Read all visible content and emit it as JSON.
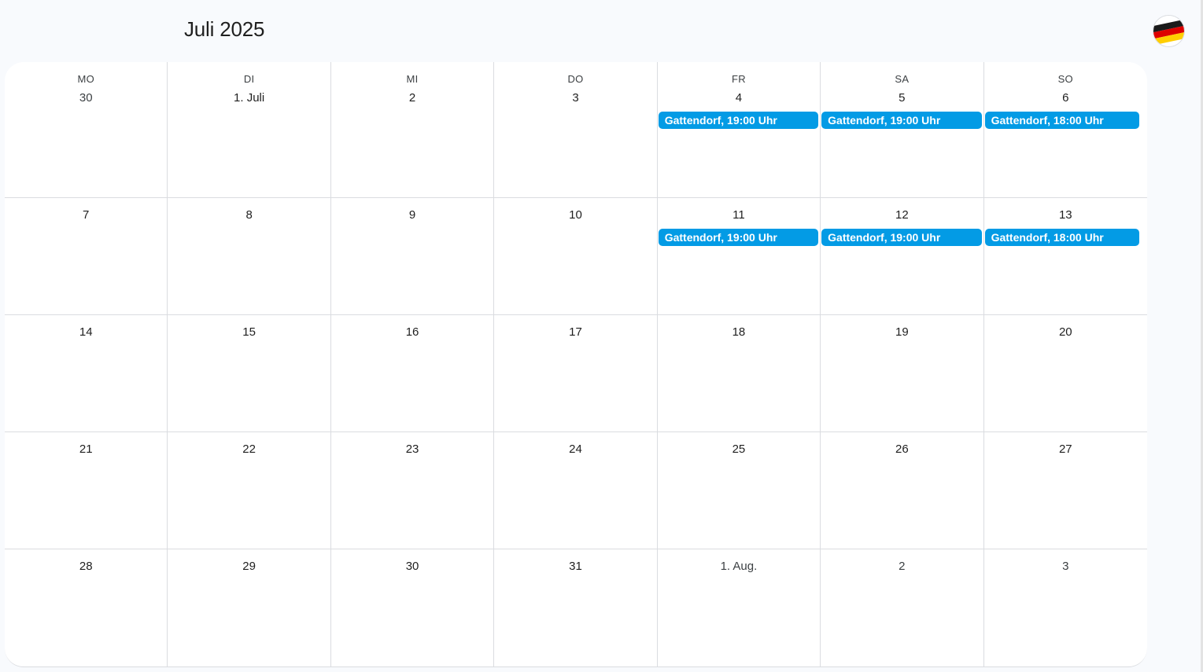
{
  "header": {
    "title": "Juli 2025",
    "avatar_icon": "flag-avatar-icon"
  },
  "colors": {
    "event": "#039be5",
    "grid_line": "#dadce0",
    "background": "#f8fafd"
  },
  "weekdays": [
    "MO",
    "DI",
    "MI",
    "DO",
    "FR",
    "SA",
    "SO"
  ],
  "weeks": [
    [
      {
        "label": "30",
        "other": true,
        "events": []
      },
      {
        "label": "1. Juli",
        "events": []
      },
      {
        "label": "2",
        "events": []
      },
      {
        "label": "3",
        "events": []
      },
      {
        "label": "4",
        "events": [
          "Gattendorf, 19:00 Uhr"
        ]
      },
      {
        "label": "5",
        "events": [
          "Gattendorf, 19:00 Uhr"
        ]
      },
      {
        "label": "6",
        "events": [
          "Gattendorf, 18:00 Uhr"
        ]
      }
    ],
    [
      {
        "label": "7",
        "events": []
      },
      {
        "label": "8",
        "events": []
      },
      {
        "label": "9",
        "events": []
      },
      {
        "label": "10",
        "events": []
      },
      {
        "label": "11",
        "events": [
          "Gattendorf, 19:00 Uhr"
        ]
      },
      {
        "label": "12",
        "events": [
          "Gattendorf, 19:00 Uhr"
        ]
      },
      {
        "label": "13",
        "events": [
          "Gattendorf, 18:00 Uhr"
        ]
      }
    ],
    [
      {
        "label": "14",
        "events": []
      },
      {
        "label": "15",
        "events": []
      },
      {
        "label": "16",
        "events": []
      },
      {
        "label": "17",
        "events": []
      },
      {
        "label": "18",
        "events": []
      },
      {
        "label": "19",
        "events": []
      },
      {
        "label": "20",
        "events": []
      }
    ],
    [
      {
        "label": "21",
        "events": []
      },
      {
        "label": "22",
        "events": []
      },
      {
        "label": "23",
        "events": []
      },
      {
        "label": "24",
        "events": []
      },
      {
        "label": "25",
        "events": []
      },
      {
        "label": "26",
        "events": []
      },
      {
        "label": "27",
        "events": []
      }
    ],
    [
      {
        "label": "28",
        "events": []
      },
      {
        "label": "29",
        "events": []
      },
      {
        "label": "30",
        "events": []
      },
      {
        "label": "31",
        "events": []
      },
      {
        "label": "1. Aug.",
        "other": true,
        "events": []
      },
      {
        "label": "2",
        "other": true,
        "events": []
      },
      {
        "label": "3",
        "other": true,
        "events": []
      }
    ]
  ]
}
